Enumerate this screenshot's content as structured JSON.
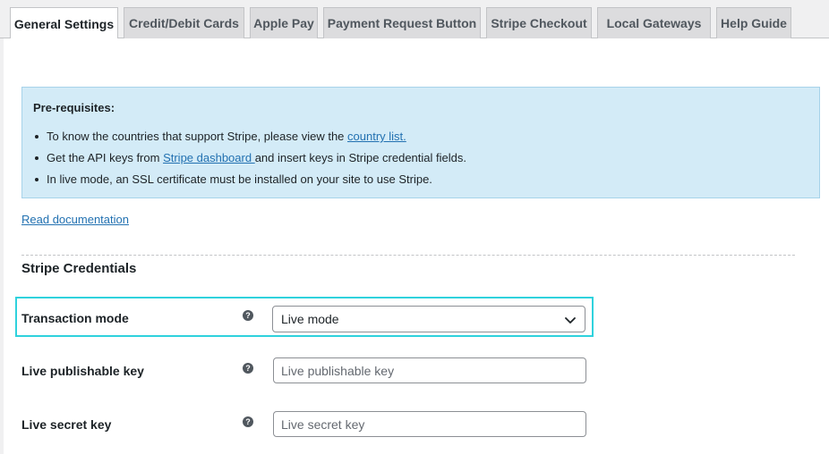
{
  "tabs": [
    {
      "label": "General Settings",
      "active": true
    },
    {
      "label": "Credit/Debit Cards"
    },
    {
      "label": "Apple Pay"
    },
    {
      "label": "Payment Request Button"
    },
    {
      "label": "Stripe Checkout"
    },
    {
      "label": "Local Gateways"
    },
    {
      "label": "Help Guide"
    }
  ],
  "notice": {
    "title": "Pre-requisites:",
    "item1_text": "To know the countries that support Stripe, please view the ",
    "item1_link": "country list.",
    "item2_text_before": "Get the API keys from ",
    "item2_link": "Stripe dashboard ",
    "item2_text_after": "and insert keys in Stripe credential fields.",
    "item3_text": "In live mode, an SSL certificate must be installed on your site to use Stripe."
  },
  "doc_link": "Read documentation",
  "section_title": "Stripe Credentials",
  "fields": {
    "transaction_mode": {
      "label": "Transaction mode",
      "value": "Live mode"
    },
    "live_publishable_key": {
      "label": "Live publishable key",
      "placeholder": "Live publishable key"
    },
    "live_secret_key": {
      "label": "Live secret key",
      "placeholder": "Live secret key"
    }
  },
  "help_glyph": "?",
  "icons": {
    "help": "question-circle-icon",
    "dropdown": "chevron-down-icon"
  },
  "colors": {
    "link": "#2271b1",
    "notice_bg": "#d3ebf7",
    "highlight": "#2fd2dd"
  }
}
